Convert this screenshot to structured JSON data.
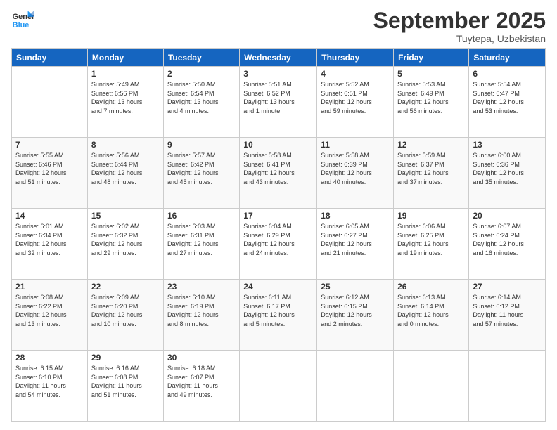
{
  "logo": {
    "line1": "General",
    "line2": "Blue"
  },
  "title": "September 2025",
  "location": "Tuytepa, Uzbekistan",
  "weekdays": [
    "Sunday",
    "Monday",
    "Tuesday",
    "Wednesday",
    "Thursday",
    "Friday",
    "Saturday"
  ],
  "weeks": [
    [
      {
        "num": "",
        "info": ""
      },
      {
        "num": "1",
        "info": "Sunrise: 5:49 AM\nSunset: 6:56 PM\nDaylight: 13 hours\nand 7 minutes."
      },
      {
        "num": "2",
        "info": "Sunrise: 5:50 AM\nSunset: 6:54 PM\nDaylight: 13 hours\nand 4 minutes."
      },
      {
        "num": "3",
        "info": "Sunrise: 5:51 AM\nSunset: 6:52 PM\nDaylight: 13 hours\nand 1 minute."
      },
      {
        "num": "4",
        "info": "Sunrise: 5:52 AM\nSunset: 6:51 PM\nDaylight: 12 hours\nand 59 minutes."
      },
      {
        "num": "5",
        "info": "Sunrise: 5:53 AM\nSunset: 6:49 PM\nDaylight: 12 hours\nand 56 minutes."
      },
      {
        "num": "6",
        "info": "Sunrise: 5:54 AM\nSunset: 6:47 PM\nDaylight: 12 hours\nand 53 minutes."
      }
    ],
    [
      {
        "num": "7",
        "info": "Sunrise: 5:55 AM\nSunset: 6:46 PM\nDaylight: 12 hours\nand 51 minutes."
      },
      {
        "num": "8",
        "info": "Sunrise: 5:56 AM\nSunset: 6:44 PM\nDaylight: 12 hours\nand 48 minutes."
      },
      {
        "num": "9",
        "info": "Sunrise: 5:57 AM\nSunset: 6:42 PM\nDaylight: 12 hours\nand 45 minutes."
      },
      {
        "num": "10",
        "info": "Sunrise: 5:58 AM\nSunset: 6:41 PM\nDaylight: 12 hours\nand 43 minutes."
      },
      {
        "num": "11",
        "info": "Sunrise: 5:58 AM\nSunset: 6:39 PM\nDaylight: 12 hours\nand 40 minutes."
      },
      {
        "num": "12",
        "info": "Sunrise: 5:59 AM\nSunset: 6:37 PM\nDaylight: 12 hours\nand 37 minutes."
      },
      {
        "num": "13",
        "info": "Sunrise: 6:00 AM\nSunset: 6:36 PM\nDaylight: 12 hours\nand 35 minutes."
      }
    ],
    [
      {
        "num": "14",
        "info": "Sunrise: 6:01 AM\nSunset: 6:34 PM\nDaylight: 12 hours\nand 32 minutes."
      },
      {
        "num": "15",
        "info": "Sunrise: 6:02 AM\nSunset: 6:32 PM\nDaylight: 12 hours\nand 29 minutes."
      },
      {
        "num": "16",
        "info": "Sunrise: 6:03 AM\nSunset: 6:31 PM\nDaylight: 12 hours\nand 27 minutes."
      },
      {
        "num": "17",
        "info": "Sunrise: 6:04 AM\nSunset: 6:29 PM\nDaylight: 12 hours\nand 24 minutes."
      },
      {
        "num": "18",
        "info": "Sunrise: 6:05 AM\nSunset: 6:27 PM\nDaylight: 12 hours\nand 21 minutes."
      },
      {
        "num": "19",
        "info": "Sunrise: 6:06 AM\nSunset: 6:25 PM\nDaylight: 12 hours\nand 19 minutes."
      },
      {
        "num": "20",
        "info": "Sunrise: 6:07 AM\nSunset: 6:24 PM\nDaylight: 12 hours\nand 16 minutes."
      }
    ],
    [
      {
        "num": "21",
        "info": "Sunrise: 6:08 AM\nSunset: 6:22 PM\nDaylight: 12 hours\nand 13 minutes."
      },
      {
        "num": "22",
        "info": "Sunrise: 6:09 AM\nSunset: 6:20 PM\nDaylight: 12 hours\nand 10 minutes."
      },
      {
        "num": "23",
        "info": "Sunrise: 6:10 AM\nSunset: 6:19 PM\nDaylight: 12 hours\nand 8 minutes."
      },
      {
        "num": "24",
        "info": "Sunrise: 6:11 AM\nSunset: 6:17 PM\nDaylight: 12 hours\nand 5 minutes."
      },
      {
        "num": "25",
        "info": "Sunrise: 6:12 AM\nSunset: 6:15 PM\nDaylight: 12 hours\nand 2 minutes."
      },
      {
        "num": "26",
        "info": "Sunrise: 6:13 AM\nSunset: 6:14 PM\nDaylight: 12 hours\nand 0 minutes."
      },
      {
        "num": "27",
        "info": "Sunrise: 6:14 AM\nSunset: 6:12 PM\nDaylight: 11 hours\nand 57 minutes."
      }
    ],
    [
      {
        "num": "28",
        "info": "Sunrise: 6:15 AM\nSunset: 6:10 PM\nDaylight: 11 hours\nand 54 minutes."
      },
      {
        "num": "29",
        "info": "Sunrise: 6:16 AM\nSunset: 6:08 PM\nDaylight: 11 hours\nand 51 minutes."
      },
      {
        "num": "30",
        "info": "Sunrise: 6:18 AM\nSunset: 6:07 PM\nDaylight: 11 hours\nand 49 minutes."
      },
      {
        "num": "",
        "info": ""
      },
      {
        "num": "",
        "info": ""
      },
      {
        "num": "",
        "info": ""
      },
      {
        "num": "",
        "info": ""
      }
    ]
  ]
}
